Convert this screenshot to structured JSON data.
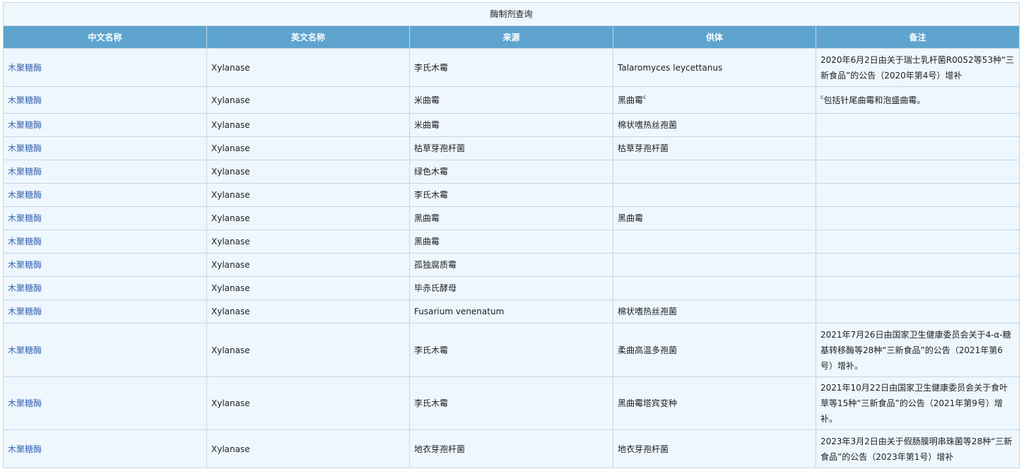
{
  "table": {
    "caption": "酶制剂查询",
    "headers": [
      "中文名称",
      "英文名称",
      "来源",
      "供体",
      "备注"
    ],
    "rows": [
      {
        "cn": "木聚糖酶",
        "en": "Xylanase",
        "source": "李氏木霉",
        "donor": "Talaromyces leycettanus",
        "donor_sup": "",
        "note_sup": "",
        "note": "2020年6月2日由关于瑞士乳杆菌R0052等53种“三新食品”的公告（2020年第4号）增补"
      },
      {
        "cn": "木聚糖酶",
        "en": "Xylanase",
        "source": "米曲霉",
        "donor": "黑曲霉",
        "donor_sup": "c",
        "note_sup": "c",
        "note": "包括针尾曲霉和泡盛曲霉。"
      },
      {
        "cn": "木聚糖酶",
        "en": "Xylanase",
        "source": "米曲霉",
        "donor": "棉状嗜热丝孢菌",
        "donor_sup": "",
        "note_sup": "",
        "note": ""
      },
      {
        "cn": "木聚糖酶",
        "en": "Xylanase",
        "source": "枯草芽孢杆菌",
        "donor": "枯草芽孢杆菌",
        "donor_sup": "",
        "note_sup": "",
        "note": ""
      },
      {
        "cn": "木聚糖酶",
        "en": "Xylanase",
        "source": "绿色木霉",
        "donor": "",
        "donor_sup": "",
        "note_sup": "",
        "note": ""
      },
      {
        "cn": "木聚糖酶",
        "en": "Xylanase",
        "source": "李氏木霉",
        "donor": "",
        "donor_sup": "",
        "note_sup": "",
        "note": ""
      },
      {
        "cn": "木聚糖酶",
        "en": "Xylanase",
        "source": "黑曲霉",
        "donor": "黑曲霉",
        "donor_sup": "",
        "note_sup": "",
        "note": ""
      },
      {
        "cn": "木聚糖酶",
        "en": "Xylanase",
        "source": "黑曲霉",
        "donor": "",
        "donor_sup": "",
        "note_sup": "",
        "note": ""
      },
      {
        "cn": "木聚糖酶",
        "en": "Xylanase",
        "source": "孤独腐质霉",
        "donor": "",
        "donor_sup": "",
        "note_sup": "",
        "note": ""
      },
      {
        "cn": "木聚糖酶",
        "en": "Xylanase",
        "source": "毕赤氏酵母",
        "donor": "",
        "donor_sup": "",
        "note_sup": "",
        "note": ""
      },
      {
        "cn": "木聚糖酶",
        "en": "Xylanase",
        "source": "Fusarium venenatum",
        "donor": "棉状嗜热丝孢菌",
        "donor_sup": "",
        "note_sup": "",
        "note": ""
      },
      {
        "cn": "木聚糖酶",
        "en": "Xylanase",
        "source": "李氏木霉",
        "donor": "柔曲高温多孢菌",
        "donor_sup": "",
        "note_sup": "",
        "note": "2021年7月26日由国家卫生健康委员会关于4-α-糖基转移酶等28种“三新食品”的公告（2021年第6号）增补。"
      },
      {
        "cn": "木聚糖酶",
        "en": "Xylanase",
        "source": "李氏木霉",
        "donor": "黑曲霉塔宾变种",
        "donor_sup": "",
        "note_sup": "",
        "note": "2021年10月22日由国家卫生健康委员会关于食叶草等15种“三新食品”的公告（2021年第9号）增补。"
      },
      {
        "cn": "木聚糖酶",
        "en": "Xylanase",
        "source": "地衣芽孢杆菌",
        "donor": "地衣芽孢杆菌",
        "donor_sup": "",
        "note_sup": "",
        "note": "2023年3月2日由关于假肠膜明串珠菌等28种“三新食品”的公告（2023年第1号）增补"
      }
    ]
  }
}
